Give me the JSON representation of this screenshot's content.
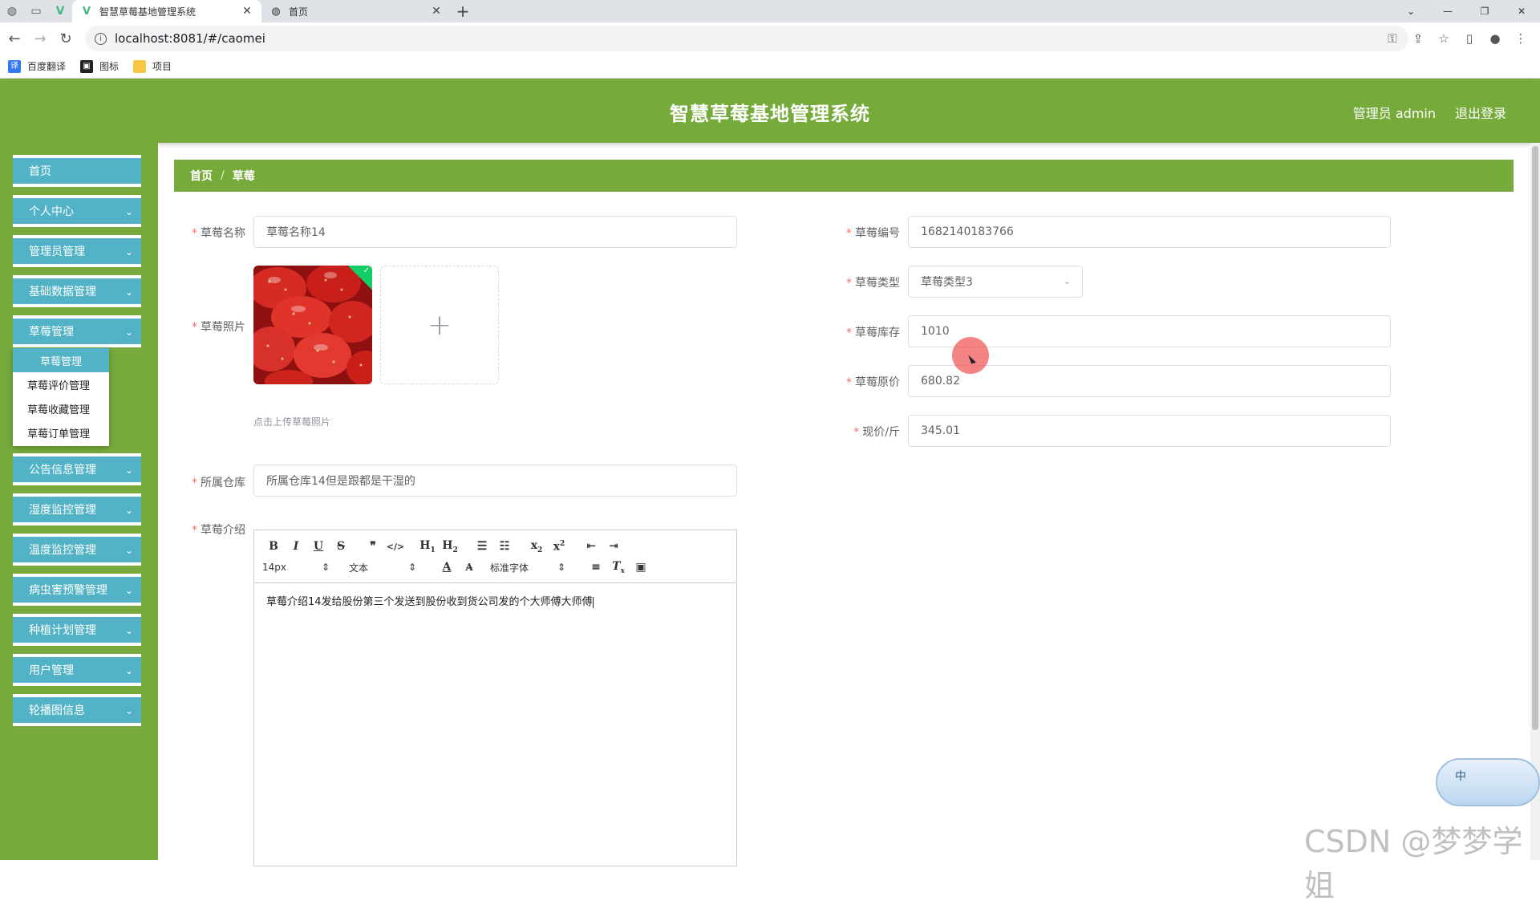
{
  "browser": {
    "tabs": [
      {
        "title": "智慧草莓基地管理系统",
        "active": true
      },
      {
        "title": "首页",
        "active": false
      }
    ],
    "url": "localhost:8081/#/caomei",
    "bookmarks": [
      "百度翻译",
      "图标",
      "项目"
    ]
  },
  "header": {
    "title": "智慧草莓基地管理系统",
    "user": "管理员 admin",
    "logout": "退出登录"
  },
  "sidebar": {
    "items": [
      {
        "label": "首页",
        "has_children": false
      },
      {
        "label": "个人中心",
        "has_children": true
      },
      {
        "label": "管理员管理",
        "has_children": true
      },
      {
        "label": "基础数据管理",
        "has_children": true
      },
      {
        "label": "草莓管理",
        "has_children": true
      },
      {
        "label": "公告信息管理",
        "has_children": true
      },
      {
        "label": "湿度监控管理",
        "has_children": true
      },
      {
        "label": "温度监控管理",
        "has_children": true
      },
      {
        "label": "病虫害预警管理",
        "has_children": true
      },
      {
        "label": "种植计划管理",
        "has_children": true
      },
      {
        "label": "用户管理",
        "has_children": true
      },
      {
        "label": "轮播图信息",
        "has_children": true
      }
    ],
    "submenu": [
      "草莓管理",
      "草莓评价管理",
      "草莓收藏管理",
      "草莓订单管理"
    ],
    "submenu_active": "草莓管理"
  },
  "breadcrumb": {
    "home": "首页",
    "current": "草莓"
  },
  "form": {
    "name_label": "草莓名称",
    "name_value": "草莓名称14",
    "photo_label": "草莓照片",
    "photo_tip": "点击上传草莓照片",
    "warehouse_label": "所属仓库",
    "warehouse_value": "所属仓库14但是跟都是干湿的",
    "intro_label": "草莓介绍",
    "code_label": "草莓编号",
    "code_value": "1682140183766",
    "type_label": "草莓类型",
    "type_value": "草莓类型3",
    "stock_label": "草莓库存",
    "stock_value": "1010",
    "orig_price_label": "草莓原价",
    "orig_price_value": "680.82",
    "cur_price_label": "现价/斤",
    "cur_price_value": "345.01"
  },
  "editor": {
    "size": "14px",
    "block": "文本",
    "font": "标准字体",
    "content": "草莓介绍14发给股份第三个发送到股份收到货公司发的个大师傅大师傅"
  },
  "widget": {
    "ime": "中"
  },
  "watermark": "CSDN @梦梦学姐",
  "colors": {
    "header": "#76ab3c",
    "menu": "#52b3c6",
    "required": "#f56c6c"
  }
}
